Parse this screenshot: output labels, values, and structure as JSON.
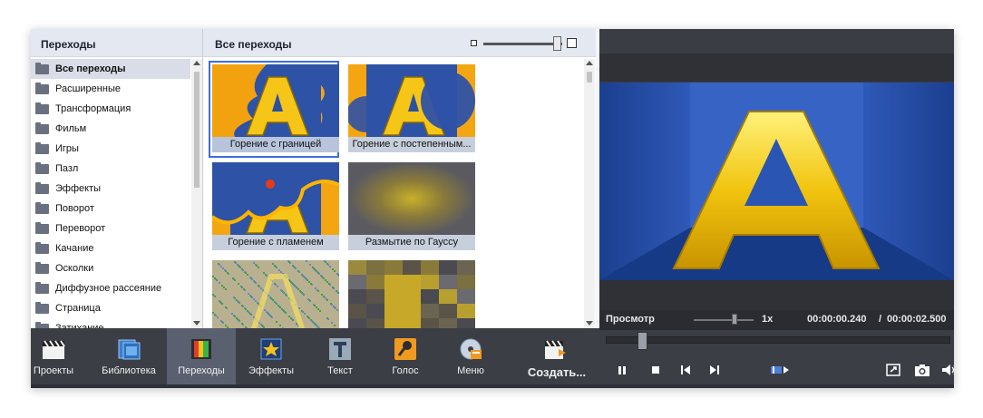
{
  "categories_panel": {
    "title": "Переходы",
    "items": [
      {
        "label": "Все переходы",
        "active": true
      },
      {
        "label": "Расширенные"
      },
      {
        "label": "Трансформация"
      },
      {
        "label": "Фильм"
      },
      {
        "label": "Игры"
      },
      {
        "label": "Пазл"
      },
      {
        "label": "Эффекты"
      },
      {
        "label": "Поворот"
      },
      {
        "label": "Переворот"
      },
      {
        "label": "Качание"
      },
      {
        "label": "Осколки"
      },
      {
        "label": "Диффузное рассеяние"
      },
      {
        "label": "Страница"
      },
      {
        "label": "Затихание"
      }
    ]
  },
  "transitions_panel": {
    "title": "Все переходы",
    "tiles": [
      {
        "label": "Горение с границей",
        "selected": true,
        "thumb": "burn-edge"
      },
      {
        "label": "Горение с постепенным...",
        "thumb": "burn-gradual"
      },
      {
        "label": "Горение с пламенем",
        "thumb": "burn-flame"
      },
      {
        "label": "Размытие по Гауссу",
        "thumb": "gauss-blur"
      },
      {
        "label": "",
        "thumb": "noise"
      },
      {
        "label": "",
        "thumb": "pixelate"
      }
    ]
  },
  "preview": {
    "label": "Просмотр",
    "speed": "1x",
    "time_current": "00:00:00.240",
    "time_separator": "/",
    "time_total": "00:00:02.500",
    "seek_fraction": 0.096
  },
  "toolbar": {
    "projects": "Проекты",
    "library": "Библиотека",
    "transitions": "Переходы",
    "effects": "Эффекты",
    "text": "Текст",
    "voice": "Голос",
    "menu": "Меню",
    "create": "Создать..."
  },
  "colors": {
    "accent": "#3c6fd8",
    "toolbar_bg": "#3b3e45",
    "toolbar_active": "#5a6070",
    "panel_header": "#e4e8f0"
  }
}
